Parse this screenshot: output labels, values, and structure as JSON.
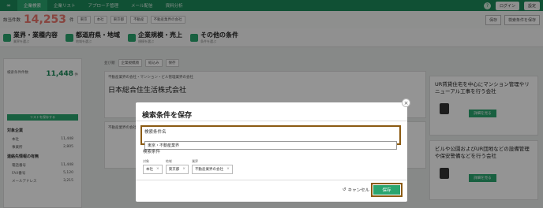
{
  "nav": {
    "logo": "∞",
    "tabs": [
      "企業検索",
      "企業リスト",
      "アプローチ管理",
      "メール配信",
      "資料分析"
    ],
    "active_tab": 0,
    "help": "?",
    "login_btn": "ログイン",
    "account_btn": "設定"
  },
  "filterbar": {
    "label": "該当件数",
    "count": "14,253",
    "count_unit": "件",
    "chips": [
      "東京",
      "本社",
      "東京都",
      "不動産",
      "不動産業界の会社"
    ],
    "save_btn": "検索条件を保存",
    "saved_btn": "保存"
  },
  "categories": [
    {
      "title": "業界・業種内容",
      "sub": "業界を選ぶ"
    },
    {
      "title": "都道府県・地域",
      "sub": "地域を選ぶ"
    },
    {
      "title": "企業規模・売上",
      "sub": "規模を選ぶ"
    },
    {
      "title": "その他の条件",
      "sub": "条件を選ぶ"
    }
  ],
  "left": {
    "count_label": "検索条件件数",
    "count": "11,448",
    "count_unit": "件",
    "btn": "リストを保存する",
    "section1": "対象企業",
    "rows1": [
      [
        "本社",
        "11,448"
      ],
      [
        "事業所",
        "2,805"
      ]
    ],
    "section2": "連絡先情報の有無",
    "rows2": [
      [
        "電話番号",
        "11,448"
      ],
      [
        "FAX番号",
        "5,120"
      ],
      [
        "メールアドレス",
        "3,215"
      ]
    ]
  },
  "results": {
    "sort_label": "並び順",
    "sort_value": "企業規模順",
    "tag1": "絞込み",
    "tag2": "保存",
    "card_header": "不動産業界の会社・マンション・ビル管理業界の会社",
    "card_name": "日本総合住生活株式会社",
    "card2_header": "不動産業界の会社"
  },
  "right": {
    "card1": "UR賃貸住宅を中心にマンション管理やリニューアル工事を行う会社",
    "card2": "ビルや公園およびUR団地などの設備管理や保安警備などを行う会社",
    "btn": "詳細を見る"
  },
  "modal": {
    "title": "検索条件を保存",
    "close": "×",
    "name_label": "検索条件名",
    "name_value": "東京・不動産業界",
    "cond_label": "検索条件",
    "conditions": [
      {
        "label": "対象",
        "value": "本社"
      },
      {
        "label": "地域",
        "value": "東京都"
      },
      {
        "label": "業界",
        "value": "不動産業界の会社"
      }
    ],
    "cancel": "キャンセル",
    "save": "保存"
  },
  "colors": {
    "brand": "#2aa56f",
    "highlight": "#8b5a12",
    "count": "#e9786d"
  }
}
